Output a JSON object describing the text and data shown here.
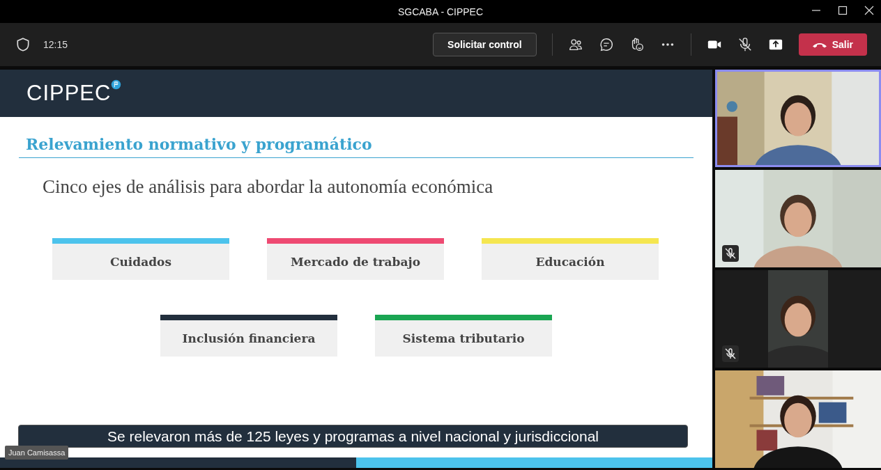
{
  "window": {
    "title": "SGCABA - CIPPEC"
  },
  "toolbar": {
    "time": "12:15",
    "control_button": "Solicitar control",
    "leave_button": "Salir",
    "camera_on": true,
    "mic_muted": true
  },
  "slide": {
    "logo": "CIPPEC",
    "title": "Relevamiento normativo y programático",
    "subtitle": "Cinco ejes de análisis para abordar la autonomía económica",
    "axes": [
      {
        "label": "Cuidados",
        "color": "#4cc3ec"
      },
      {
        "label": "Mercado de trabajo",
        "color": "#ee4a72"
      },
      {
        "label": "Educación",
        "color": "#f5e650"
      },
      {
        "label": "Inclusión financiera",
        "color": "#222f3d"
      },
      {
        "label": "Sistema tributario",
        "color": "#1aa552"
      }
    ],
    "caption": "Se relevaron más de 125 leyes y programas a nivel nacional y jurisdiccional"
  },
  "presenter_name": "Juan Camisassa",
  "participants": [
    {
      "selected": true,
      "muted": false,
      "kind": "full"
    },
    {
      "selected": false,
      "muted": true,
      "kind": "full"
    },
    {
      "selected": false,
      "muted": true,
      "kind": "portrait"
    },
    {
      "selected": false,
      "muted": false,
      "kind": "full"
    }
  ]
}
